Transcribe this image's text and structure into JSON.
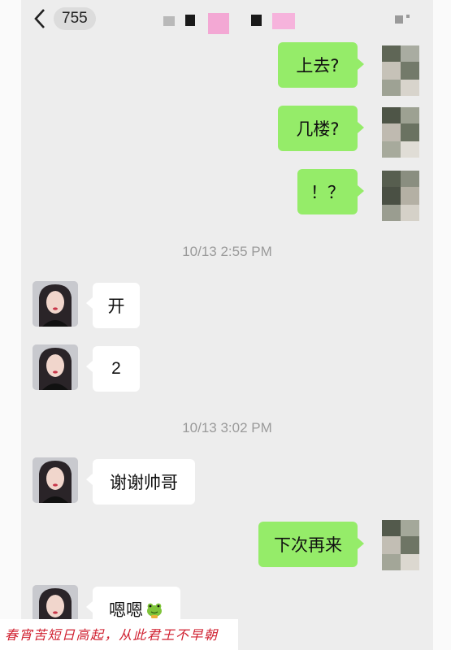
{
  "header": {
    "unread_count": "755",
    "back_icon": "chevron-left-icon",
    "title_censored": true,
    "more_icon": "more-icon"
  },
  "messages": [
    {
      "side": "out",
      "text": "上去?"
    },
    {
      "side": "out",
      "text": "几楼?"
    },
    {
      "side": "out",
      "text": "！？"
    },
    {
      "side": "timestamp",
      "text": "10/13 2:55 PM"
    },
    {
      "side": "in",
      "text": "开"
    },
    {
      "side": "in",
      "text": "2"
    },
    {
      "side": "timestamp",
      "text": "10/13 3:02 PM"
    },
    {
      "side": "in",
      "text": "谢谢帅哥"
    },
    {
      "side": "out",
      "text": "下次再来"
    },
    {
      "side": "in",
      "text": "嗯嗯",
      "emoji": "frog-emoji-icon"
    }
  ],
  "caption": "春宵苦短日高起，从此君王不早朝",
  "colors": {
    "chat_background": "#ededed",
    "outgoing_bubble": "#95ec69",
    "incoming_bubble": "#ffffff",
    "timestamp_text": "#9a9a9a",
    "caption_text": "#d02030"
  }
}
